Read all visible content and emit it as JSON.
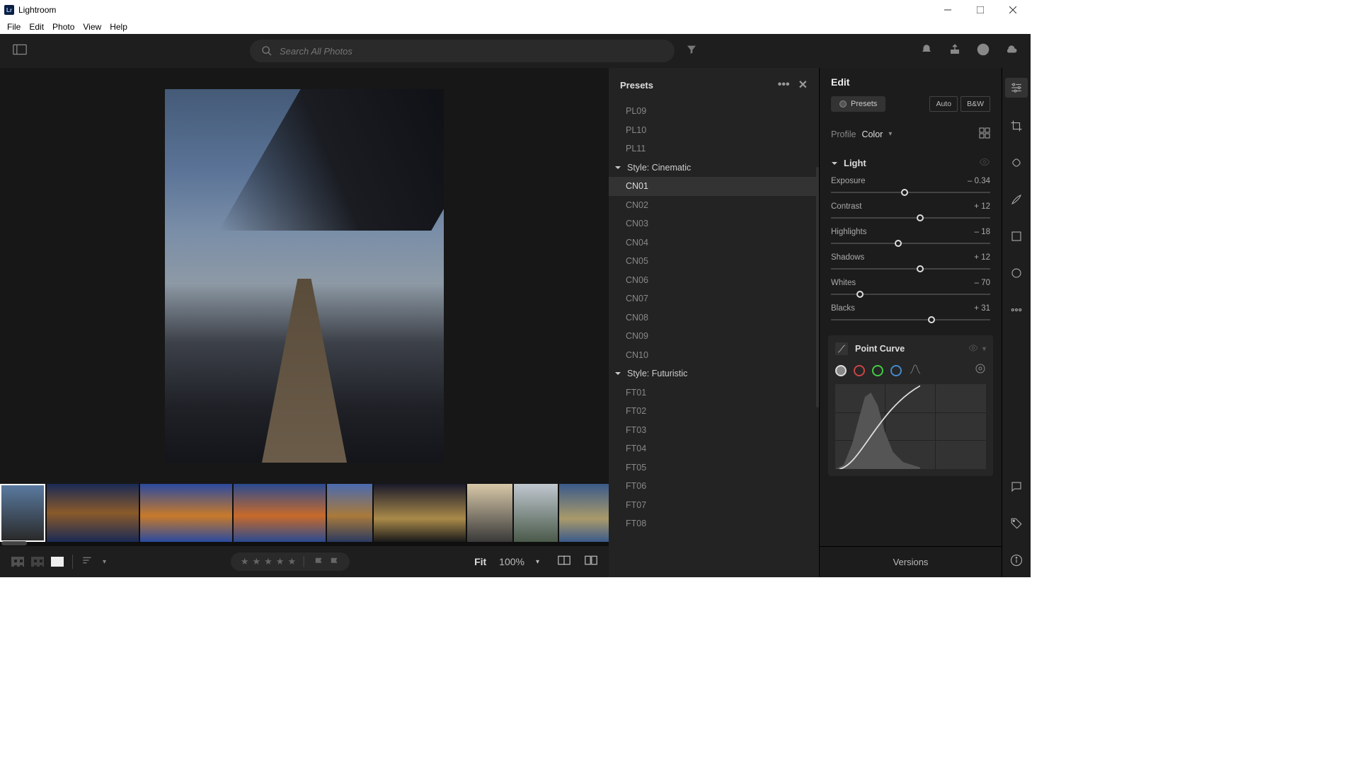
{
  "app": {
    "title": "Lightroom",
    "logo_text": "Lr"
  },
  "menubar": [
    "File",
    "Edit",
    "Photo",
    "View",
    "Help"
  ],
  "toolbar": {
    "search_placeholder": "Search All Photos"
  },
  "presets": {
    "title": "Presets",
    "items_before": [
      "PL09",
      "PL10",
      "PL11"
    ],
    "group1": "Style: Cinematic",
    "cinematic": [
      "CN01",
      "CN02",
      "CN03",
      "CN04",
      "CN05",
      "CN06",
      "CN07",
      "CN08",
      "CN09",
      "CN10"
    ],
    "selected": "CN01",
    "group2": "Style: Futuristic",
    "futuristic": [
      "FT01",
      "FT02",
      "FT03",
      "FT04",
      "FT05",
      "FT06",
      "FT07",
      "FT08"
    ]
  },
  "edit": {
    "title": "Edit",
    "presets_btn": "Presets",
    "auto_btn": "Auto",
    "bw_btn": "B&W",
    "profile_label": "Profile",
    "profile_value": "Color",
    "light_label": "Light",
    "sliders": [
      {
        "label": "Exposure",
        "value": "– 0.34",
        "pos": 46
      },
      {
        "label": "Contrast",
        "value": "+ 12",
        "pos": 56
      },
      {
        "label": "Highlights",
        "value": "– 18",
        "pos": 42
      },
      {
        "label": "Shadows",
        "value": "+ 12",
        "pos": 56
      },
      {
        "label": "Whites",
        "value": "– 70",
        "pos": 18
      },
      {
        "label": "Blacks",
        "value": "+ 31",
        "pos": 63
      }
    ],
    "pointcurve_label": "Point Curve",
    "versions_label": "Versions"
  },
  "bottombar": {
    "fit": "Fit",
    "zoom": "100%"
  },
  "filmstrip_widths": [
    64,
    130,
    130,
    130,
    64,
    130,
    64,
    62,
    96,
    60,
    82,
    40
  ],
  "thumb_gradients": [
    "linear-gradient(180deg,#5a7aa0,#2a2a2a)",
    "linear-gradient(180deg,#1a2a55,#8a5a2a 50%,#1a2a55)",
    "linear-gradient(180deg,#2a4aa0,#c87a2a 55%,#2a4aa0)",
    "linear-gradient(180deg,#2a4a90,#c86a2a 55%,#2a4a90)",
    "linear-gradient(180deg,#4a6ab0,#aa7a3a 55%,#2a3a60)",
    "linear-gradient(180deg,#1a1a2a,#aa8a4a 60%,#1a1a1a)",
    "linear-gradient(180deg,#d8c8a8,#3a3a3a)",
    "linear-gradient(180deg,#c0c8d0,#4a5a4a)",
    "linear-gradient(180deg,#3a5a8a,#aa9a6a 60%,#3a5a8a)",
    "linear-gradient(180deg,#aab8c8,#4a7a5a 60%,#3a5a6a)",
    "linear-gradient(180deg,#b8b8c0,#5a6a5a)",
    "linear-gradient(180deg,#a8b0b8,#5a6a6a)"
  ]
}
